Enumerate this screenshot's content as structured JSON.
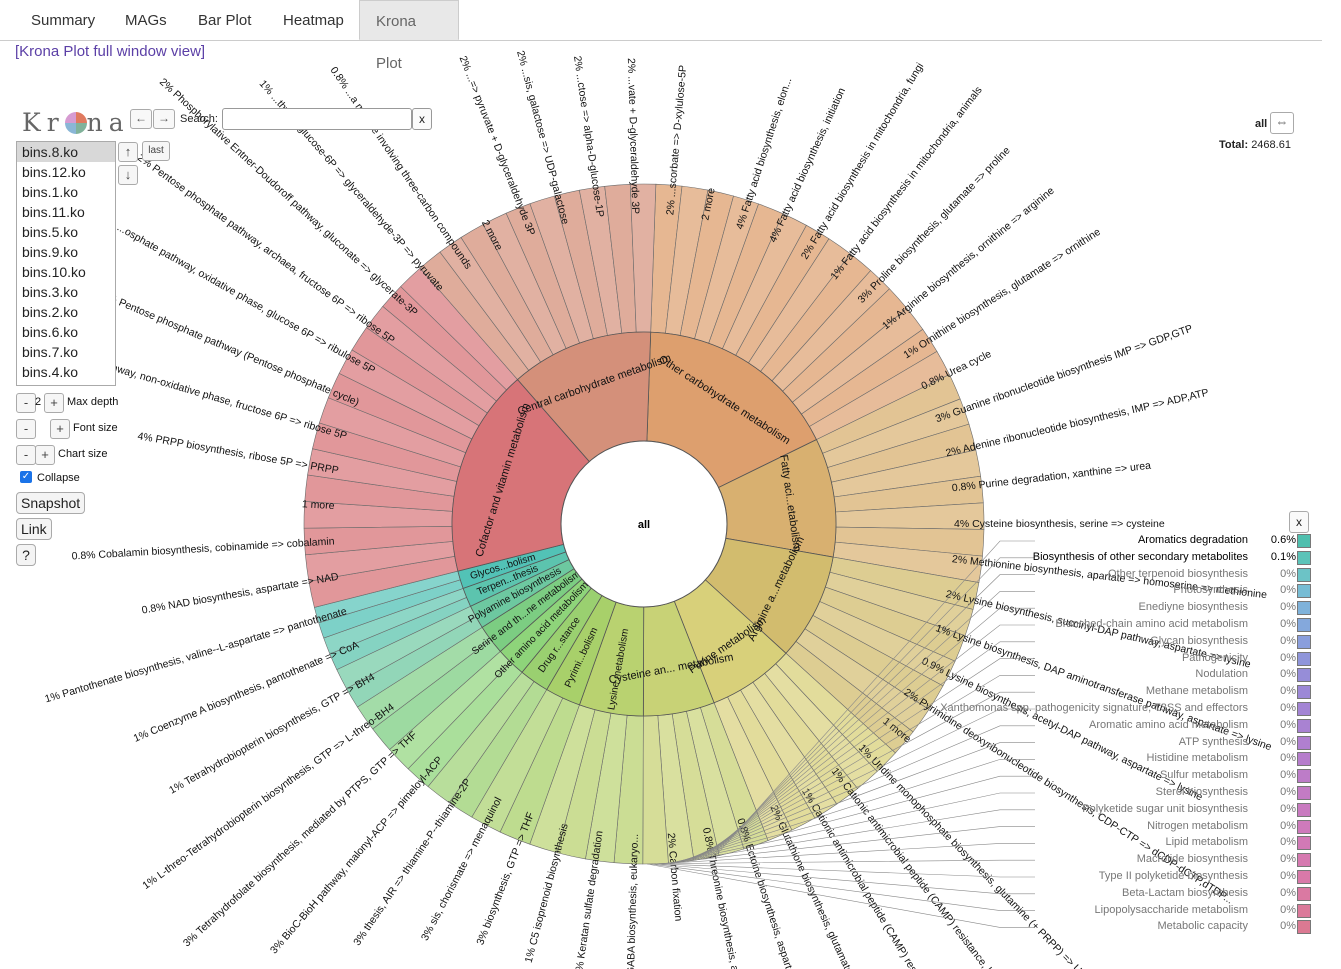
{
  "tabs": [
    "Summary",
    "MAGs",
    "Bar Plot",
    "Heatmap",
    "Krona Plot"
  ],
  "active_tab": "Krona Plot",
  "fullview_link": "[Krona Plot full window view]",
  "krona": {
    "logo": "Krona",
    "search_label": "Search:",
    "search_value": "",
    "search_clear": "x",
    "last_label": "last",
    "datasets": [
      "bins.8.ko",
      "bins.12.ko",
      "bins.1.ko",
      "bins.11.ko",
      "bins.5.ko",
      "bins.9.ko",
      "bins.10.ko",
      "bins.3.ko",
      "bins.2.ko",
      "bins.6.ko",
      "bins.7.ko",
      "bins.4.ko"
    ],
    "selected_dataset": "bins.8.ko",
    "max_depth_value": "2",
    "max_depth_label": "Max depth",
    "font_size_label": "Font size",
    "chart_size_label": "Chart size",
    "collapse_label": "Collapse",
    "snapshot_label": "Snapshot",
    "link_label": "Link",
    "help_label": "?",
    "focus_name": "all",
    "total_label": "Total:",
    "total_value": "2468.61",
    "center_label": "all"
  },
  "chart_data": {
    "type": "sunburst",
    "root": "all",
    "rings": {
      "level1": [
        {
          "name": "Other carbohydrate metabolism",
          "pct": 17.2,
          "color": "#dd9f6e"
        },
        {
          "name": "Fatty aci...etabolism",
          "pct": 10.0,
          "color": "#d8b070"
        },
        {
          "name": "Arginine a...metabolism",
          "pct": 9.0,
          "color": "#d2bc6e"
        },
        {
          "name": "Purine metabolism",
          "pct": 7.3,
          "color": "#d8d07a"
        },
        {
          "name": "Cysteine an... metabolism",
          "pct": 6.0,
          "color": "#c8d276"
        },
        {
          "name": "Lysine metabolism",
          "pct": 5.4,
          "color": "#b9d270"
        },
        {
          "name": "Pyrimi...bolism",
          "pct": 3.0,
          "color": "#a8d06a"
        },
        {
          "name": "Drug r...stance",
          "pct": 2.5,
          "color": "#9ad070"
        },
        {
          "name": "Other amino acid metabolism",
          "pct": 2.5,
          "color": "#8ed47a"
        },
        {
          "name": "Serine and th...ne metabolism",
          "pct": 2.5,
          "color": "#7ccd82"
        },
        {
          "name": "Polyamine biosynthesis",
          "pct": 2.0,
          "color": "#6dc8a0"
        },
        {
          "name": "Terpen...thesis",
          "pct": 1.6,
          "color": "#5cc4ae"
        },
        {
          "name": "Glycos...bolism",
          "pct": 1.5,
          "color": "#52c2b6"
        },
        {
          "name": "Cofactor and vitamin metabolism",
          "pct": 17.5,
          "color": "#d77478"
        },
        {
          "name": "Central carbohydrate metabolism",
          "pct": 12.0,
          "color": "#d4907a"
        }
      ],
      "level2_labels": [
        {
          "name": "Fatty acid biosynthesis, elon...",
          "pct": "4%"
        },
        {
          "name": "Fatty acid biosynthesis, initiation",
          "pct": "4%"
        },
        {
          "name": "Fatty acid biosynthesis in mitochondria, fungi",
          "pct": "2%"
        },
        {
          "name": "Fatty acid biosynthesis in mitochondria, animals",
          "pct": "1%"
        },
        {
          "name": "Proline biosynthesis, glutamate => proline",
          "pct": "3%"
        },
        {
          "name": "Arginine biosynthesis, ornithine => arginine",
          "pct": "1%"
        },
        {
          "name": "Ornithine biosynthesis, glutamate => ornithine",
          "pct": "1%"
        },
        {
          "name": "Urea cycle",
          "pct": "0.8%"
        },
        {
          "name": "Guanine ribonucleotide biosynthesis IMP => GDP,GTP",
          "pct": "3%"
        },
        {
          "name": "Adenine ribonucleotide biosynthesis, IMP => ADP,ATP",
          "pct": "2%"
        },
        {
          "name": "Purine degradation, xanthine => urea",
          "pct": "0.8%"
        },
        {
          "name": "Cysteine biosynthesis, serine => cysteine",
          "pct": "4%"
        },
        {
          "name": "Methionine biosynthesis, apartate => homoserine => methionine",
          "pct": "2%"
        },
        {
          "name": "Lysine biosynthesis, succinyl-DAP pathway, aspartate => lysine",
          "pct": "2%"
        },
        {
          "name": "Lysine biosynthesis, DAP aminotransferase pathway, aspartate => lysine",
          "pct": "1%"
        },
        {
          "name": "Lysine biosynthesis, acetyl-DAP pathway, aspartate => lysine",
          "pct": "0.9%"
        },
        {
          "name": "Pyrimidine deoxyribonucleotide biosynthesis, CDP-CTP => dCDP-dCTP,dTDP...",
          "pct": "2%"
        },
        {
          "name": "1 more",
          "pct": ""
        },
        {
          "name": "Uridine monophosphate biosynthesis, glutamine (+ PRPP) => UMP",
          "pct": "1%"
        },
        {
          "name": "Cationic antimicrobial peptide (CAMP) resistance, lysyl...",
          "pct": "1%"
        },
        {
          "name": "Cationic antimicrobial peptide (CAMP) resistan...",
          "pct": "1%"
        },
        {
          "name": "Glutathione biosynthesis, glutamate =>",
          "pct": "2%"
        },
        {
          "name": "Ectoine biosynthesis, aspartate =>",
          "pct": "0.8%"
        },
        {
          "name": "Threonine biosynthesis, asparta...",
          "pct": "0.8%"
        },
        {
          "name": "Carbon fixation",
          "pct": "2%"
        },
        {
          "name": "GABA biosynthesis, eukaryo...",
          "pct": "1%"
        },
        {
          "name": "Keratan sulfate degradation",
          "pct": "1%"
        },
        {
          "name": "C5 isoprenoid biosynthesis",
          "pct": "1%"
        },
        {
          "name": "biosynthesis, GTP => THF",
          "pct": "3%"
        },
        {
          "name": "sis, chorismate => menaquinol",
          "pct": "3%"
        },
        {
          "name": "thesis, AIR => thiamine-P--thiamine-2P",
          "pct": "3%"
        },
        {
          "name": "BioC-BioH pathway, malonyl-ACP => pimeloyl-ACP",
          "pct": "3%"
        },
        {
          "name": "Tetrahydrofolate biosynthesis, mediated by PTPS, GTP => THF",
          "pct": "3%"
        },
        {
          "name": "L-threo-Tetrahydrobiopterin biosynthesis, GTP => L-threo-BH4",
          "pct": "1%"
        },
        {
          "name": "Tetrahydrobiopterin biosynthesis, GTP => BH4",
          "pct": "1%"
        },
        {
          "name": "Coenzyme A biosynthesis, pantothenate => CoA",
          "pct": "1%"
        },
        {
          "name": "Pantothenate biosynthesis, valine--L-aspartate => pantothenate",
          "pct": "1%"
        },
        {
          "name": "NAD biosynthesis, aspartate => NAD",
          "pct": "0.8%"
        },
        {
          "name": "Cobalamin biosynthesis, cobinamide => cobalamin",
          "pct": "0.8%"
        },
        {
          "name": "1 more",
          "pct": ""
        },
        {
          "name": "PRPP biosynthesis, ribose 5P => PRPP",
          "pct": "4%"
        },
        {
          "name": "...phosphate pathway, non-oxidative phase, fructose 6P => ribose 5P",
          "pct": "3%"
        },
        {
          "name": "Pentose phosphate pathway (Pentose phosphate cycle)",
          "pct": "2%"
        },
        {
          "name": "...osphate pathway, oxidative phase, glucose 6P => ribulose 5P",
          "pct": "2%"
        },
        {
          "name": "Pentose phosphate pathway, archaea, fructose 6P => ribose 5P",
          "pct": "2%"
        },
        {
          "name": "Phosphorylative Entner-Doudoroff pathway, gluconate => glycerate-3P",
          "pct": "2%"
        },
        {
          "name": "...thway, glucose-6P => glyceraldehyde-3P => pyruvate",
          "pct": "1%"
        },
        {
          "name": "...a module involving three-carbon compounds",
          "pct": "0.8%"
        },
        {
          "name": "2 more",
          "pct": ""
        },
        {
          "name": "...=> pyruvate + D-glyceraldehyde 3P",
          "pct": "2%"
        },
        {
          "name": "...sis, galactose => UDP-galactose",
          "pct": "2%"
        },
        {
          "name": "...ctose => alpha-D-glucose-1P",
          "pct": "2%"
        },
        {
          "name": "...vate + D-glyceraldehyde 3P",
          "pct": "2%"
        },
        {
          "name": "...scorbate => D-xylulose-5P",
          "pct": "2%"
        },
        {
          "name": "2 more",
          "pct": ""
        }
      ]
    },
    "legend": [
      {
        "name": "Aromatics degradation",
        "pct": "0.6%",
        "color": "#4fbfae",
        "bold": true
      },
      {
        "name": "Biosynthesis of other secondary metabolites",
        "pct": "0.1%",
        "color": "#5cc3b8",
        "bold": true
      },
      {
        "name": "Other terpenoid biosynthesis",
        "pct": "0%",
        "color": "#6cc3c6"
      },
      {
        "name": "Photosynthesis",
        "pct": "0%",
        "color": "#77bcd4"
      },
      {
        "name": "Enediyne biosynthesis",
        "pct": "0%",
        "color": "#7fb2da"
      },
      {
        "name": "Branched-chain amino acid metabolism",
        "pct": "0%",
        "color": "#84a8dc"
      },
      {
        "name": "Glycan biosynthesis",
        "pct": "0%",
        "color": "#8a9edc"
      },
      {
        "name": "Pathogenicity",
        "pct": "0%",
        "color": "#8f95da"
      },
      {
        "name": "Nodulation",
        "pct": "0%",
        "color": "#968dd8"
      },
      {
        "name": "Methane metabolism",
        "pct": "0%",
        "color": "#9c88d6"
      },
      {
        "name": "Xanthomonas spp. pathogenicity signature, T3SS and effectors",
        "pct": "0%",
        "color": "#a384d4"
      },
      {
        "name": "Aromatic amino acid metabolism",
        "pct": "0%",
        "color": "#a982d2"
      },
      {
        "name": "ATP synthesis",
        "pct": "0%",
        "color": "#b07fd0"
      },
      {
        "name": "Histidine metabolism",
        "pct": "0%",
        "color": "#b67dcc"
      },
      {
        "name": "Sulfur metabolism",
        "pct": "0%",
        "color": "#bd7cc8"
      },
      {
        "name": "Sterol biosynthesis",
        "pct": "0%",
        "color": "#c37bc4"
      },
      {
        "name": "Polyketide sugar unit biosynthesis",
        "pct": "0%",
        "color": "#c97ac0"
      },
      {
        "name": "Nitrogen metabolism",
        "pct": "0%",
        "color": "#ce7abb"
      },
      {
        "name": "Lipid metabolism",
        "pct": "0%",
        "color": "#d279b6"
      },
      {
        "name": "Macrolide biosynthesis",
        "pct": "0%",
        "color": "#d679b0"
      },
      {
        "name": "Type II polyketide biosynthesis",
        "pct": "0%",
        "color": "#d979a9"
      },
      {
        "name": "Beta-Lactam biosynthesis",
        "pct": "0%",
        "color": "#da79a2"
      },
      {
        "name": "Lipopolysaccharide metabolism",
        "pct": "0%",
        "color": "#db799a"
      },
      {
        "name": "Metabolic capacity",
        "pct": "0%",
        "color": "#db7992"
      }
    ]
  }
}
